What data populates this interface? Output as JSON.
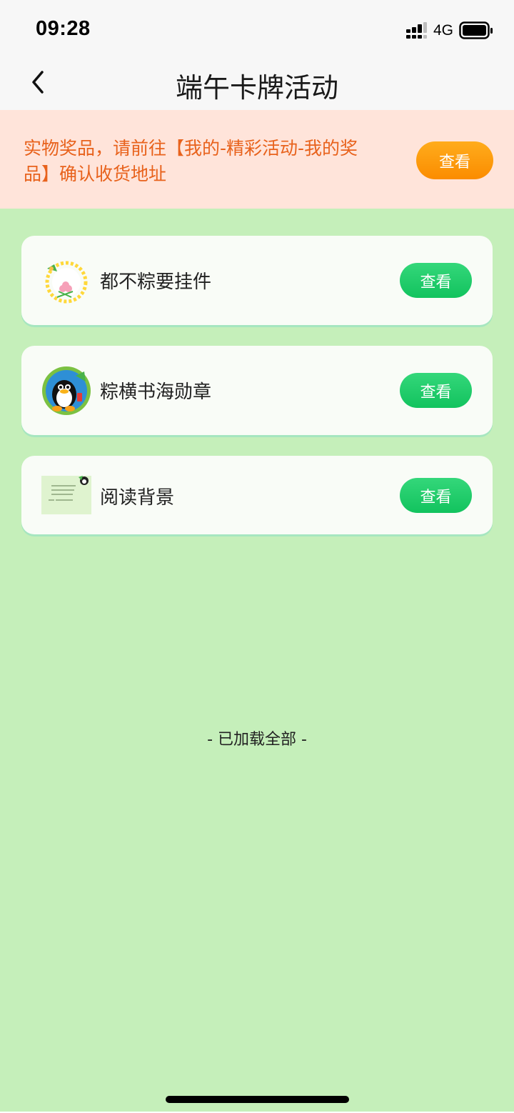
{
  "status_bar": {
    "time": "09:28",
    "network": "4G",
    "signal_icon": "cellular-signal-icon",
    "battery_icon": "battery-icon"
  },
  "nav": {
    "back_icon": "chevron-left-icon",
    "title": "端午卡牌活动"
  },
  "notice": {
    "text": "实物奖品，请前往【我的-精彩活动-我的奖品】确认收货地址",
    "button_label": "查看"
  },
  "rewards": [
    {
      "label": "都不粽要挂件",
      "icon": "pendant-icon",
      "button_label": "查看"
    },
    {
      "label": "粽横书海勋章",
      "icon": "penguin-medal-icon",
      "button_label": "查看"
    },
    {
      "label": "阅读背景",
      "icon": "reading-background-thumbnail",
      "button_label": "查看"
    }
  ],
  "footer": {
    "text": "- 已加载全部 -"
  },
  "colors": {
    "page_bg": "#c5efba",
    "notice_bg": "#ffe4da",
    "notice_text": "#e8621c",
    "orange_button": "#fb8c00",
    "green_button": "#12c35e"
  }
}
